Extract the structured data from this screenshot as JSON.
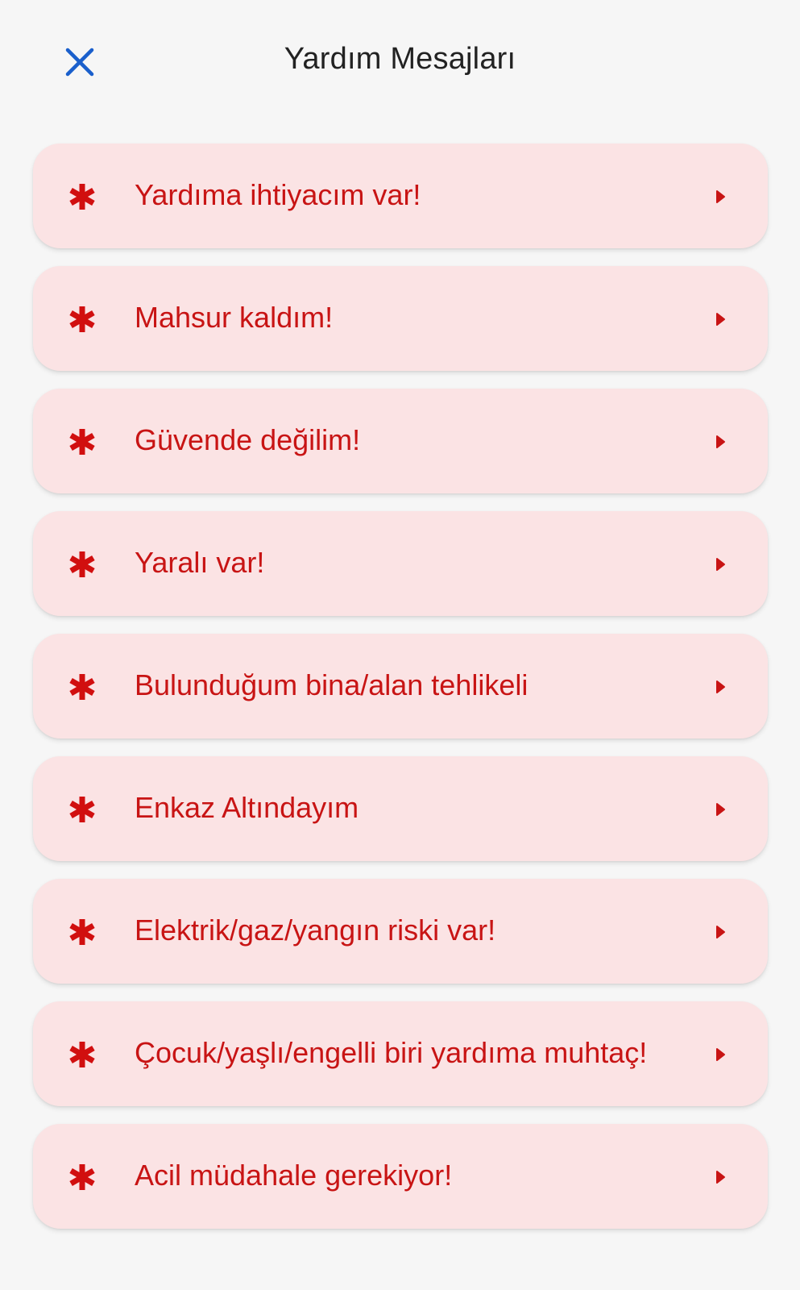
{
  "header": {
    "title": "Yardım Mesajları",
    "close_icon": "close-icon"
  },
  "colors": {
    "background": "#f6f6f6",
    "item_background": "#fbe3e4",
    "accent_red": "#c81414",
    "close_blue": "#1a5fcc",
    "title_text": "#222222"
  },
  "messages": [
    {
      "label": "Yardıma ihtiyacım var!",
      "icon": "asterisk-icon",
      "trailing_icon": "play-arrow-icon"
    },
    {
      "label": "Mahsur kaldım!",
      "icon": "asterisk-icon",
      "trailing_icon": "play-arrow-icon"
    },
    {
      "label": "Güvende değilim!",
      "icon": "asterisk-icon",
      "trailing_icon": "play-arrow-icon"
    },
    {
      "label": "Yaralı var!",
      "icon": "asterisk-icon",
      "trailing_icon": "play-arrow-icon"
    },
    {
      "label": "Bulunduğum bina/alan tehlikeli",
      "icon": "asterisk-icon",
      "trailing_icon": "play-arrow-icon"
    },
    {
      "label": "Enkaz Altındayım",
      "icon": "asterisk-icon",
      "trailing_icon": "play-arrow-icon"
    },
    {
      "label": "Elektrik/gaz/yangın riski var!",
      "icon": "asterisk-icon",
      "trailing_icon": "play-arrow-icon"
    },
    {
      "label": "Çocuk/yaşlı/engelli biri yardıma muhtaç!",
      "icon": "asterisk-icon",
      "trailing_icon": "play-arrow-icon"
    },
    {
      "label": "Acil müdahale gerekiyor!",
      "icon": "asterisk-icon",
      "trailing_icon": "play-arrow-icon"
    }
  ]
}
